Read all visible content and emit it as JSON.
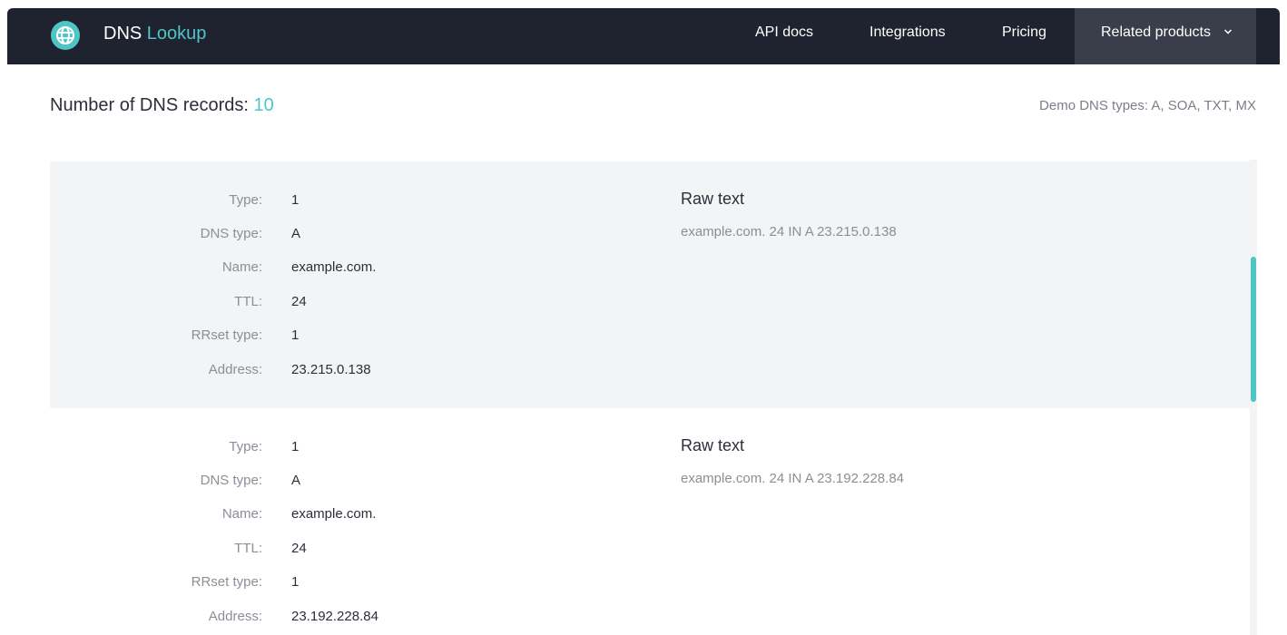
{
  "header": {
    "brand_main": "DNS",
    "brand_accent": "Lookup",
    "nav": {
      "api_docs": "API docs",
      "integrations": "Integrations",
      "pricing": "Pricing",
      "related_products": "Related products"
    },
    "logo_icon": "globe-icon",
    "related_icon": "chevron-down-icon"
  },
  "summary": {
    "count_label": "Number of DNS records:",
    "count_value": "10",
    "demo_types": "Demo DNS types: A, SOA, TXT, MX"
  },
  "labels": {
    "type": "Type:",
    "dns_type": "DNS type:",
    "name": "Name:",
    "ttl": "TTL:",
    "rrset_type": "RRset type:",
    "address": "Address:",
    "raw_text": "Raw text"
  },
  "records": [
    {
      "type": "1",
      "dns_type": "A",
      "name": "example.com.",
      "ttl": "24",
      "rrset_type": "1",
      "address": "23.215.0.138",
      "raw": "example.com. 24 IN A 23.215.0.138"
    },
    {
      "type": "1",
      "dns_type": "A",
      "name": "example.com.",
      "ttl": "24",
      "rrset_type": "1",
      "address": "23.192.228.84",
      "raw": "example.com. 24 IN A 23.192.228.84"
    }
  ],
  "colors": {
    "header_bg": "#1f2330",
    "accent": "#4ec6c7",
    "record_shade": "#f3f4f5"
  }
}
